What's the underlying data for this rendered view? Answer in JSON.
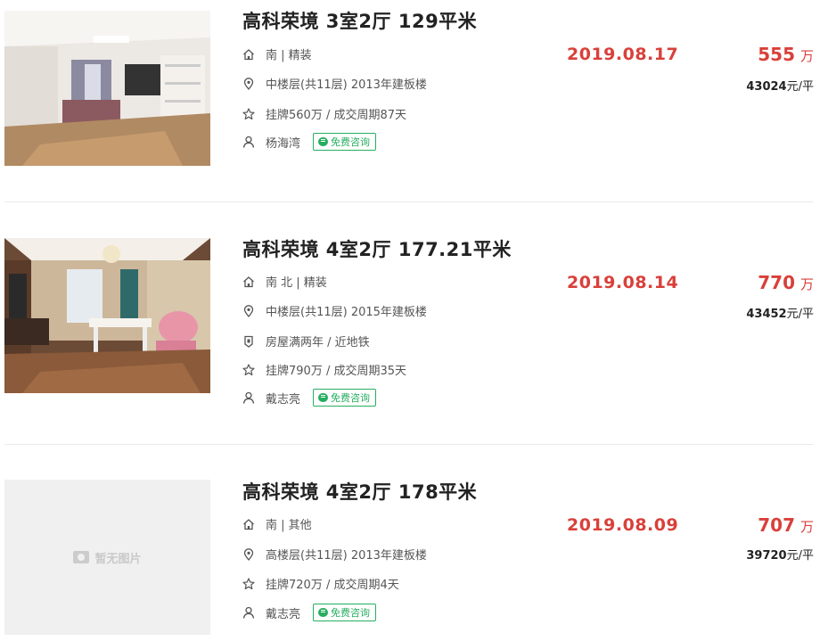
{
  "listings": [
    {
      "title": "高科荣境 3室2厅 129平米",
      "house_info": "南 | 精装",
      "position_info": "中楼层(共11层) 2013年建板楼",
      "deal_cycle": "挂牌560万 / 成交周期87天",
      "agent": "杨海湾",
      "consult_label": "免费咨询",
      "deal_date": "2019.08.17",
      "total_price": "555",
      "price_unit": "万",
      "unit_price": "43024",
      "unit_price_suffix": "元/平"
    },
    {
      "title": "高科荣境 4室2厅 177.21平米",
      "house_info": "南 北 | 精装",
      "position_info": "中楼层(共11层) 2015年建板楼",
      "tag_info": "房屋满两年 / 近地铁",
      "deal_cycle": "挂牌790万 / 成交周期35天",
      "agent": "戴志亮",
      "consult_label": "免费咨询",
      "deal_date": "2019.08.14",
      "total_price": "770",
      "price_unit": "万",
      "unit_price": "43452",
      "unit_price_suffix": "元/平"
    },
    {
      "title": "高科荣境 4室2厅 178平米",
      "house_info": "南 | 其他",
      "position_info": "高楼层(共11层) 2013年建板楼",
      "deal_cycle": "挂牌720万 / 成交周期4天",
      "agent": "戴志亮",
      "consult_label": "免费咨询",
      "deal_date": "2019.08.09",
      "total_price": "707",
      "price_unit": "万",
      "unit_price": "39720",
      "unit_price_suffix": "元/平",
      "no_image_label": "暂无图片"
    }
  ],
  "icons": {
    "house": "house-icon",
    "location": "location-pin-icon",
    "star": "star-icon",
    "user": "user-icon",
    "tag": "tag-shield-icon",
    "chat": "chat-bubble-icon",
    "camera": "camera-icon"
  },
  "colors": {
    "price_red": "#d9403a",
    "consult_green": "#27ae60",
    "divider": "#e8e8e8"
  }
}
